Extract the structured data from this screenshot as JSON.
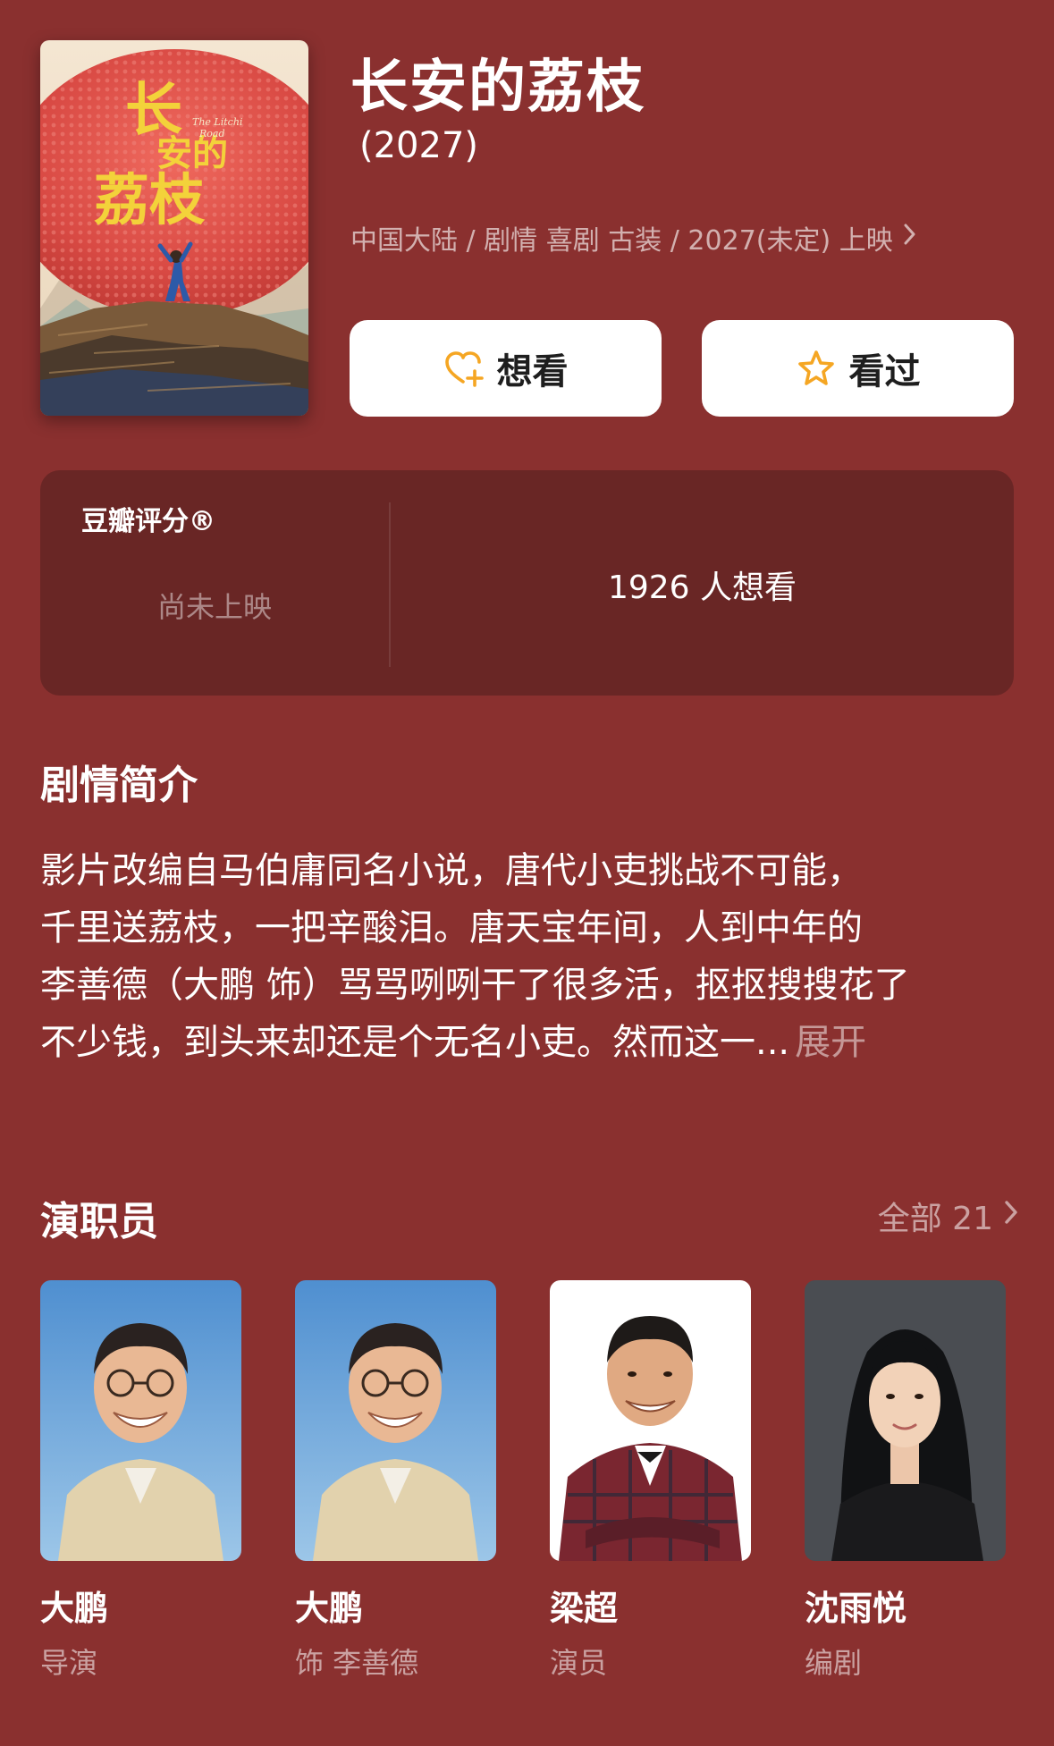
{
  "movie": {
    "title": "长安的荔枝",
    "year": "(2027)",
    "meta": "中国大陆 / 剧情 喜剧 古装 / 2027(未定) 上映",
    "poster_alt": "长安的荔枝 poster"
  },
  "actions": {
    "want_label": "想看",
    "seen_label": "看过"
  },
  "rating": {
    "label": "豆瓣评分®",
    "status": "尚未上映",
    "wish_count": "1926 人想看"
  },
  "synopsis": {
    "title": "剧情简介",
    "lines": [
      "影片改编自马伯庸同名小说，唐代小吏挑战不可能，",
      "千里送荔枝，一把辛酸泪。唐天宝年间，人到中年的",
      "李善德（大鹏 饰）骂骂咧咧干了很多活，抠抠搜搜花了",
      "不少钱，到头来却还是个无名小吏。然而这一..."
    ],
    "expand_label": "展开"
  },
  "cast": {
    "title": "演职员",
    "all_label": "全部 21",
    "members": [
      {
        "name": "大鹏",
        "role": "导演"
      },
      {
        "name": "大鹏",
        "role": "饰 李善德"
      },
      {
        "name": "梁超",
        "role": "演员"
      },
      {
        "name": "沈雨悦",
        "role": "编剧"
      }
    ]
  },
  "icons": {
    "chevron": "chevron-right-icon",
    "want": "heart-plus-icon",
    "seen": "star-outline-icon"
  },
  "colors": {
    "background": "#8a302f",
    "card": "#692625",
    "accent": "#f5a623"
  }
}
